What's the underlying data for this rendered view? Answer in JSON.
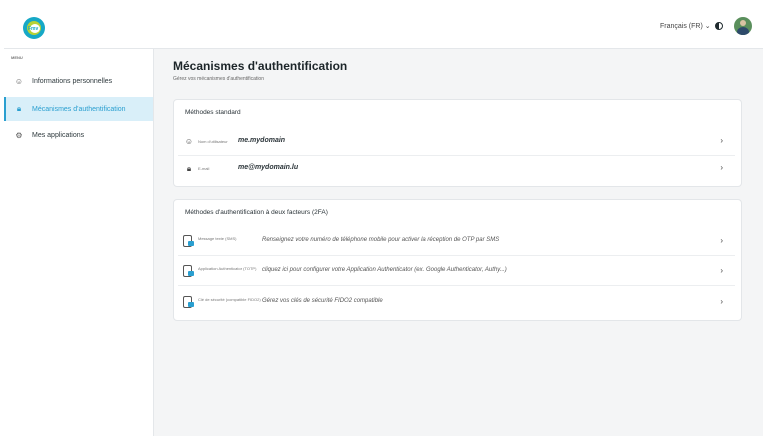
{
  "header": {
    "logo_text": "Fmv",
    "language": "Français (FR) ⌄",
    "theme_icon": "contrast-icon",
    "avatar_icon": "avatar"
  },
  "sidebar": {
    "menu_label": "MENU",
    "items": [
      {
        "label": "Informations personnelles",
        "icon": "user-circle-icon",
        "active": false
      },
      {
        "label": "Mécanismes d'authentification",
        "icon": "lock-icon",
        "active": true
      },
      {
        "label": "Mes applications",
        "icon": "apps-icon",
        "active": false
      }
    ]
  },
  "main": {
    "title": "Mécanismes d'authentification",
    "subtitle": "Gérez vos mécanismes d'authentification"
  },
  "standard": {
    "title": "Méthodes standard",
    "rows": [
      {
        "icon": "user-circle-icon",
        "label": "Nom d'utilisateur",
        "value": "me.mydomain"
      },
      {
        "icon": "lock-icon",
        "label": "E-mail",
        "value": "me@mydomain.lu"
      }
    ]
  },
  "twofa": {
    "title": "Méthodes d'authentification à deux facteurs (2FA)",
    "rows": [
      {
        "icon": "phone-lock-icon",
        "label": "Message texte (SMS)",
        "desc": "Renseignez votre numéro de téléphone mobile pour activer la réception de OTP par SMS"
      },
      {
        "icon": "phone-lock-icon",
        "label": "Application Authenticator (TOTP)",
        "desc": "cliquez ici pour configurer votre Application Authenticator (ex. Google Authenticator, Authy...)"
      },
      {
        "icon": "phone-lock-icon",
        "label": "Clé de sécurité (compatible FIDO2)",
        "desc": "Gérez vos clés de sécurité FIDO2 compatible"
      }
    ]
  },
  "colors": {
    "accent": "#2a9fd0",
    "active_bg": "#d9eff9",
    "page_bg": "#f4f5f6"
  }
}
